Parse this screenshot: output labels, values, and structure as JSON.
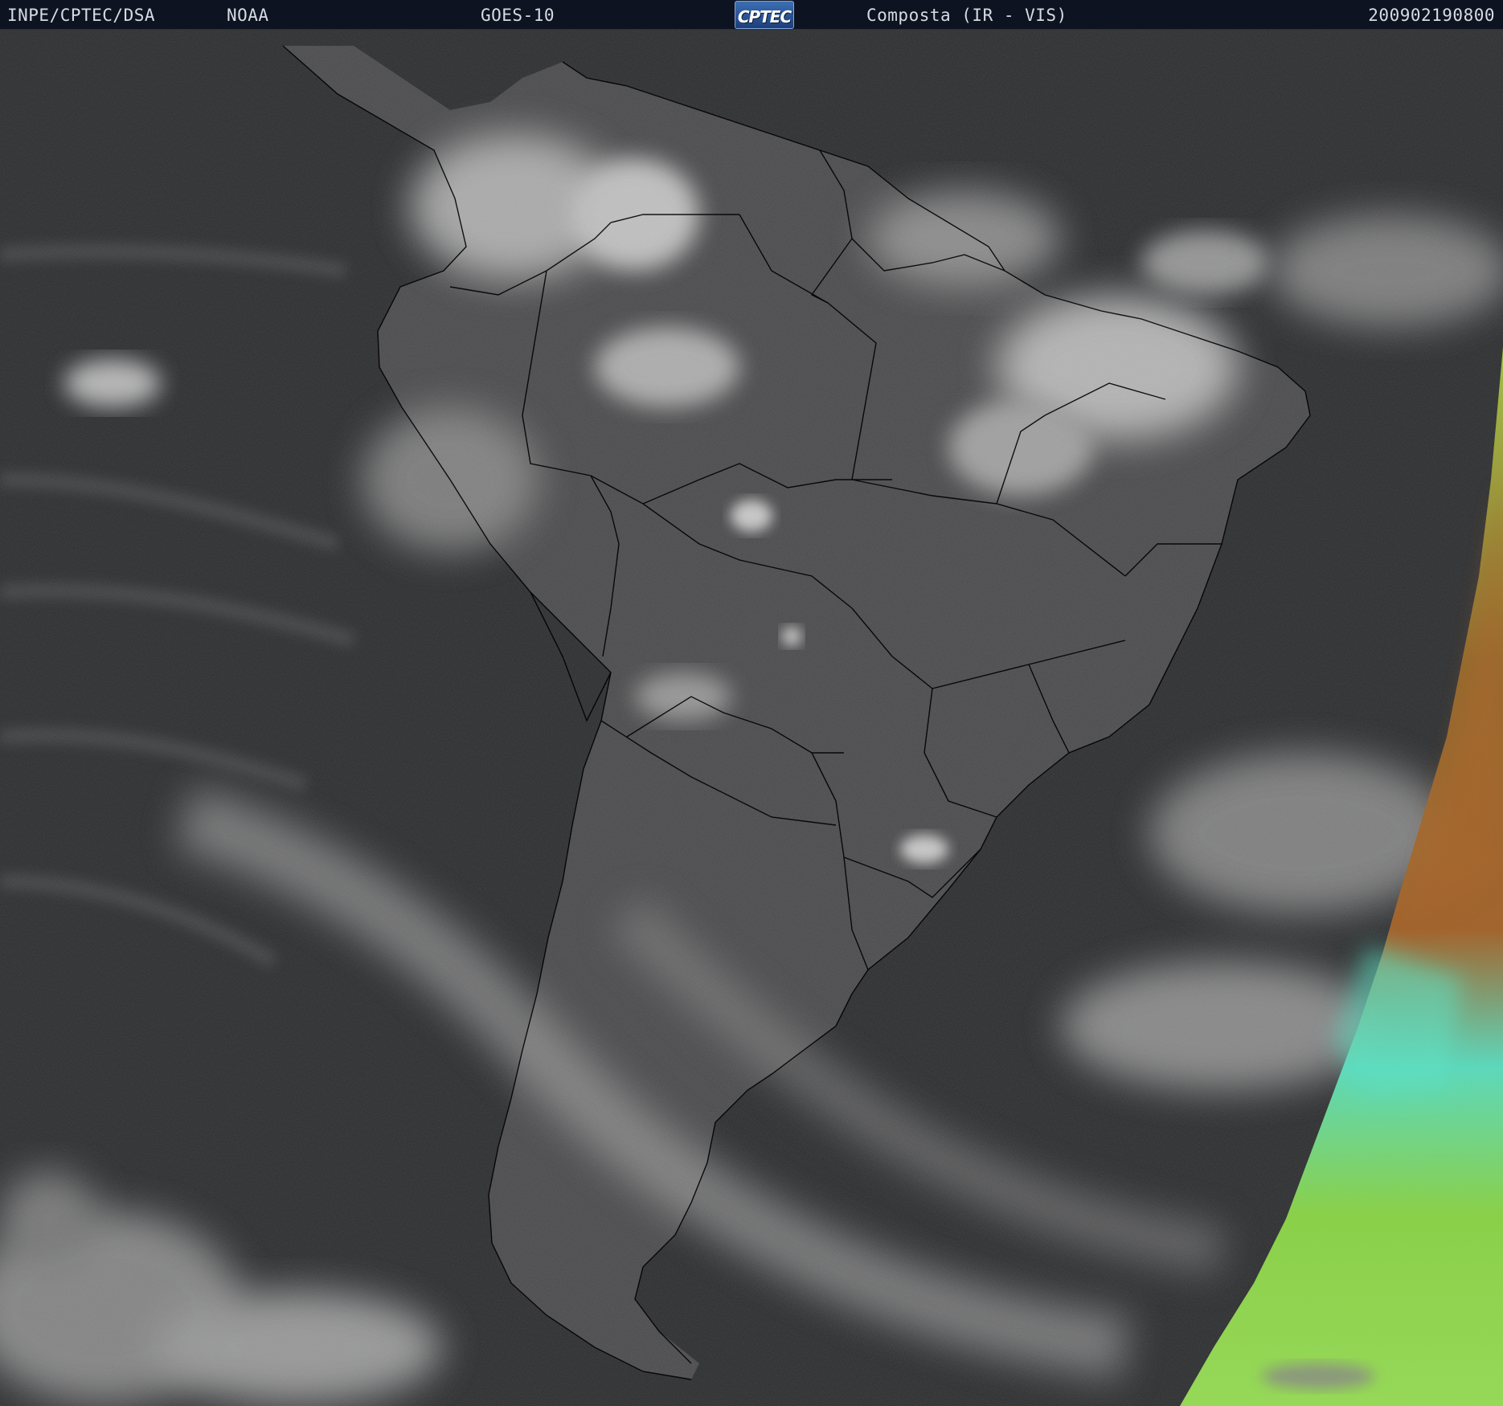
{
  "header": {
    "organization": "INPE/CPTEC/DSA",
    "agency": "NOAA",
    "satellite": "GOES-10",
    "logo_text": "CPTEC",
    "product": "Composta (IR - VIS)",
    "timestamp": "200902190800"
  },
  "map": {
    "region": "South America",
    "colors": {
      "ocean_dark": "#2b2c2e",
      "land_gray": "#505052",
      "cloud_white": "#cfcfcf",
      "border_line": "#000000",
      "vis_swath_green": "#8fd84a",
      "vis_swath_cyan": "#5fe0c2",
      "vis_swath_brown": "#a8672e"
    }
  }
}
